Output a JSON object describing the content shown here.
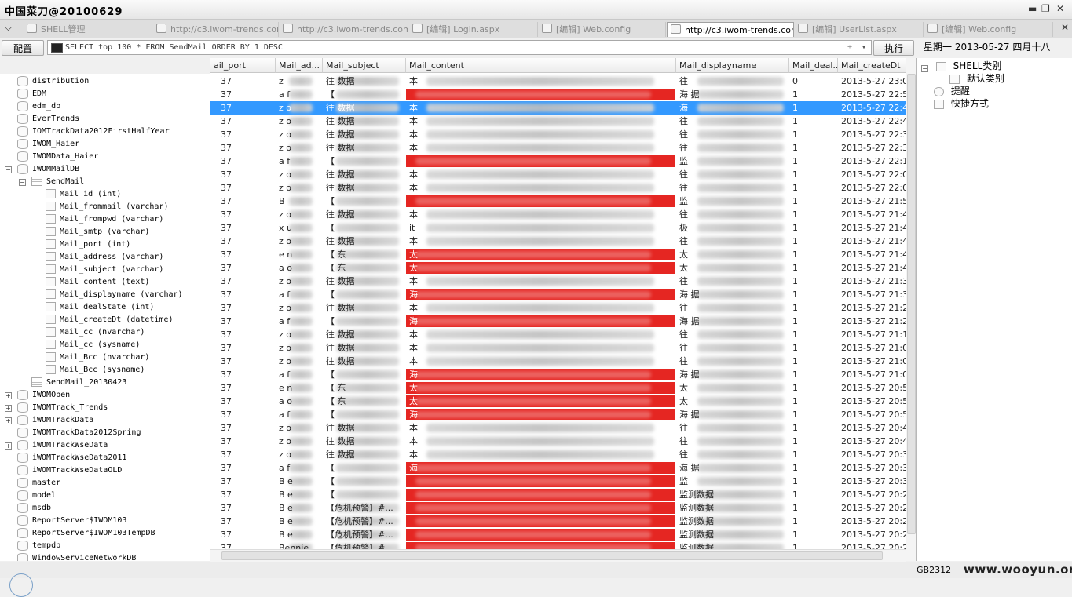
{
  "window": {
    "title": "中国菜刀@20100629",
    "controls": [
      "▬",
      "❐",
      "✕"
    ]
  },
  "tabs": [
    {
      "label": "SHELL管理",
      "active": false
    },
    {
      "label": "http://c3.iwom-trends.com...",
      "active": false
    },
    {
      "label": "http://c3.iwom-trends.com...",
      "active": false
    },
    {
      "label": "[编辑] Login.aspx",
      "active": false
    },
    {
      "label": "[编辑] Web.config",
      "active": false
    },
    {
      "label": "http://c3.iwom-trends.com...",
      "active": true
    },
    {
      "label": "[编辑] UserList.aspx",
      "active": false
    },
    {
      "label": "[编辑] Web.config",
      "active": false
    }
  ],
  "toolbar": {
    "config_label": "配置",
    "sql": "SELECT top 100 * FROM SendMail ORDER BY 1 DESC",
    "execute_label": "执行",
    "datetime": "星期一 2013-05-27 四月十八"
  },
  "db_tree": [
    {
      "label": "distribution",
      "level": 0,
      "expander": ""
    },
    {
      "label": "EDM",
      "level": 0,
      "expander": ""
    },
    {
      "label": "edm_db",
      "level": 0,
      "expander": ""
    },
    {
      "label": "EverTrends",
      "level": 0,
      "expander": ""
    },
    {
      "label": "IOMTrackData2012FirstHalfYear",
      "level": 0,
      "expander": ""
    },
    {
      "label": "IWOM_Haier",
      "level": 0,
      "expander": ""
    },
    {
      "label": "IWOMData_Haier",
      "level": 0,
      "expander": ""
    },
    {
      "label": "IWOMMailDB",
      "level": 0,
      "expander": "−"
    },
    {
      "label": "SendMail",
      "level": 1,
      "expander": "−",
      "kind": "tbl"
    },
    {
      "label": "Mail_id (int)",
      "level": 2,
      "expander": "",
      "kind": "col"
    },
    {
      "label": "Mail_frommail (varchar)",
      "level": 2,
      "expander": "",
      "kind": "col"
    },
    {
      "label": "Mail_frompwd (varchar)",
      "level": 2,
      "expander": "",
      "kind": "col"
    },
    {
      "label": "Mail_smtp (varchar)",
      "level": 2,
      "expander": "",
      "kind": "col"
    },
    {
      "label": "Mail_port (int)",
      "level": 2,
      "expander": "",
      "kind": "col"
    },
    {
      "label": "Mail_address (varchar)",
      "level": 2,
      "expander": "",
      "kind": "col"
    },
    {
      "label": "Mail_subject (varchar)",
      "level": 2,
      "expander": "",
      "kind": "col"
    },
    {
      "label": "Mail_content (text)",
      "level": 2,
      "expander": "",
      "kind": "col"
    },
    {
      "label": "Mail_displayname (varchar)",
      "level": 2,
      "expander": "",
      "kind": "col"
    },
    {
      "label": "Mail_dealState (int)",
      "level": 2,
      "expander": "",
      "kind": "col"
    },
    {
      "label": "Mail_createDt (datetime)",
      "level": 2,
      "expander": "",
      "kind": "col"
    },
    {
      "label": "Mail_cc (nvarchar)",
      "level": 2,
      "expander": "",
      "kind": "col"
    },
    {
      "label": "Mail_cc (sysname)",
      "level": 2,
      "expander": "",
      "kind": "col"
    },
    {
      "label": "Mail_Bcc (nvarchar)",
      "level": 2,
      "expander": "",
      "kind": "col"
    },
    {
      "label": "Mail_Bcc (sysname)",
      "level": 2,
      "expander": "",
      "kind": "col"
    },
    {
      "label": "SendMail_20130423",
      "level": 1,
      "expander": "",
      "kind": "tbl"
    },
    {
      "label": "IWOMOpen",
      "level": 0,
      "expander": "+"
    },
    {
      "label": "IWOMTrack_Trends",
      "level": 0,
      "expander": "+"
    },
    {
      "label": "iWOMTrackData",
      "level": 0,
      "expander": "+"
    },
    {
      "label": "IWOMTrackData2012Spring",
      "level": 0,
      "expander": ""
    },
    {
      "label": "iWOMTrackWseData",
      "level": 0,
      "expander": "+"
    },
    {
      "label": "iWOMTrackWseData2011",
      "level": 0,
      "expander": ""
    },
    {
      "label": "iWOMTrackWseDataOLD",
      "level": 0,
      "expander": ""
    },
    {
      "label": "master",
      "level": 0,
      "expander": ""
    },
    {
      "label": "model",
      "level": 0,
      "expander": ""
    },
    {
      "label": "msdb",
      "level": 0,
      "expander": ""
    },
    {
      "label": "ReportServer$IWOM103",
      "level": 0,
      "expander": ""
    },
    {
      "label": "ReportServer$IWOM103TempDB",
      "level": 0,
      "expander": ""
    },
    {
      "label": "tempdb",
      "level": 0,
      "expander": ""
    },
    {
      "label": "WindowServiceNetworkDB",
      "level": 0,
      "expander": ""
    }
  ],
  "grid": {
    "columns": [
      "ail_port",
      "Mail_ad...",
      "Mail_subject",
      "Mail_content",
      "Mail_displayname",
      "Mail_deal...",
      "Mail_createDt"
    ],
    "rows": [
      {
        "port": "37",
        "addr": "z",
        "subject": "往 数据",
        "content": "本",
        "red": false,
        "display": "往",
        "deal": "0",
        "created": "2013-5-27 23:0",
        "sel": false
      },
      {
        "port": "37",
        "addr": "a  f",
        "subject": "【",
        "content": "",
        "red": true,
        "display": "海  据",
        "deal": "1",
        "created": "2013-5-27 22:5",
        "sel": false
      },
      {
        "port": "37",
        "addr": "z  o",
        "subject": "往 数据",
        "content": "本",
        "red": false,
        "display": "海",
        "deal": "1",
        "created": "2013-5-27 22:4",
        "sel": true
      },
      {
        "port": "37",
        "addr": "z  o",
        "subject": "往 数据",
        "content": "本",
        "red": false,
        "display": "往",
        "deal": "1",
        "created": "2013-5-27 22:4",
        "sel": false
      },
      {
        "port": "37",
        "addr": "z  o",
        "subject": "往 数据",
        "content": "本",
        "red": false,
        "display": "往",
        "deal": "1",
        "created": "2013-5-27 22:3",
        "sel": false
      },
      {
        "port": "37",
        "addr": "z  o",
        "subject": "往 数据",
        "content": "本",
        "red": false,
        "display": "往",
        "deal": "1",
        "created": "2013-5-27 22:3",
        "sel": false
      },
      {
        "port": "37",
        "addr": "a  f",
        "subject": "【",
        "content": "",
        "red": true,
        "display": "监",
        "deal": "1",
        "created": "2013-5-27 22:1",
        "sel": false
      },
      {
        "port": "37",
        "addr": "z  o",
        "subject": "往 数据",
        "content": "本",
        "red": false,
        "display": "往",
        "deal": "1",
        "created": "2013-5-27 22:0",
        "sel": false
      },
      {
        "port": "37",
        "addr": "z  o",
        "subject": "往 数据",
        "content": "本",
        "red": false,
        "display": "往",
        "deal": "1",
        "created": "2013-5-27 22:0",
        "sel": false
      },
      {
        "port": "37",
        "addr": "B",
        "subject": "【",
        "content": "",
        "red": true,
        "display": "监",
        "deal": "1",
        "created": "2013-5-27 21:5",
        "sel": false
      },
      {
        "port": "37",
        "addr": "z  o",
        "subject": "往 数据",
        "content": "本",
        "red": false,
        "display": "往",
        "deal": "1",
        "created": "2013-5-27 21:4",
        "sel": false
      },
      {
        "port": "37",
        "addr": "x  u",
        "subject": "【",
        "content": "it",
        "red": false,
        "display": "极",
        "deal": "1",
        "created": "2013-5-27 21:4",
        "sel": false
      },
      {
        "port": "37",
        "addr": "z  o",
        "subject": "往 数据",
        "content": "本",
        "red": false,
        "display": "往",
        "deal": "1",
        "created": "2013-5-27 21:4",
        "sel": false
      },
      {
        "port": "37",
        "addr": "e  n",
        "subject": "【 东",
        "content": "太",
        "red": true,
        "display": "太",
        "deal": "1",
        "created": "2013-5-27 21:4",
        "sel": false
      },
      {
        "port": "37",
        "addr": "a  o",
        "subject": "【 东",
        "content": "太",
        "red": true,
        "display": "太",
        "deal": "1",
        "created": "2013-5-27 21:4",
        "sel": false
      },
      {
        "port": "37",
        "addr": "z  o",
        "subject": "往 数据",
        "content": "本",
        "red": false,
        "display": "往",
        "deal": "1",
        "created": "2013-5-27 21:3",
        "sel": false
      },
      {
        "port": "37",
        "addr": "a  f",
        "subject": "【",
        "content": "海",
        "red": true,
        "display": "海  据",
        "deal": "1",
        "created": "2013-5-27 21:3",
        "sel": false
      },
      {
        "port": "37",
        "addr": "z  o",
        "subject": "往 数据",
        "content": "本",
        "red": false,
        "display": "往",
        "deal": "1",
        "created": "2013-5-27 21:2",
        "sel": false
      },
      {
        "port": "37",
        "addr": "a  f",
        "subject": "【",
        "content": "海",
        "red": true,
        "display": "海  据",
        "deal": "1",
        "created": "2013-5-27 21:2",
        "sel": false
      },
      {
        "port": "37",
        "addr": "z  o",
        "subject": "往 数据",
        "content": "本",
        "red": false,
        "display": "往",
        "deal": "1",
        "created": "2013-5-27 21:1",
        "sel": false
      },
      {
        "port": "37",
        "addr": "z  o",
        "subject": "往 数据",
        "content": "本",
        "red": false,
        "display": "往",
        "deal": "1",
        "created": "2013-5-27 21:0",
        "sel": false
      },
      {
        "port": "37",
        "addr": "z  o",
        "subject": "往 数据",
        "content": "本",
        "red": false,
        "display": "往",
        "deal": "1",
        "created": "2013-5-27 21:0",
        "sel": false
      },
      {
        "port": "37",
        "addr": "a  f",
        "subject": "【",
        "content": "海",
        "red": true,
        "display": "海  据",
        "deal": "1",
        "created": "2013-5-27 21:0",
        "sel": false
      },
      {
        "port": "37",
        "addr": "e  n",
        "subject": "【 东",
        "content": "太",
        "red": true,
        "display": "太",
        "deal": "1",
        "created": "2013-5-27 20:5",
        "sel": false
      },
      {
        "port": "37",
        "addr": "a  o",
        "subject": "【 东",
        "content": "太",
        "red": true,
        "display": "太",
        "deal": "1",
        "created": "2013-5-27 20:5",
        "sel": false
      },
      {
        "port": "37",
        "addr": "a  f",
        "subject": "【",
        "content": "海",
        "red": true,
        "display": "海  据",
        "deal": "1",
        "created": "2013-5-27 20:5",
        "sel": false
      },
      {
        "port": "37",
        "addr": "z  o",
        "subject": "往 数据",
        "content": "本",
        "red": false,
        "display": "往",
        "deal": "1",
        "created": "2013-5-27 20:4",
        "sel": false
      },
      {
        "port": "37",
        "addr": "z  o",
        "subject": "往 数据",
        "content": "本",
        "red": false,
        "display": "往",
        "deal": "1",
        "created": "2013-5-27 20:4",
        "sel": false
      },
      {
        "port": "37",
        "addr": "z  o",
        "subject": "往 数据",
        "content": "本",
        "red": false,
        "display": "往",
        "deal": "1",
        "created": "2013-5-27 20:3",
        "sel": false
      },
      {
        "port": "37",
        "addr": "a  f",
        "subject": "【",
        "content": "海",
        "red": true,
        "display": "海  据",
        "deal": "1",
        "created": "2013-5-27 20:3",
        "sel": false
      },
      {
        "port": "37",
        "addr": "B  e",
        "subject": "【",
        "content": "",
        "red": true,
        "display": "监",
        "deal": "1",
        "created": "2013-5-27 20:3",
        "sel": false
      },
      {
        "port": "37",
        "addr": "B  e",
        "subject": "【",
        "content": "",
        "red": true,
        "display": "监测数据",
        "deal": "1",
        "created": "2013-5-27 20:2",
        "sel": false
      },
      {
        "port": "37",
        "addr": "B  e",
        "subject": "【危机预警】#...",
        "content": "",
        "red": true,
        "display": "监测数据",
        "deal": "1",
        "created": "2013-5-27 20:2",
        "sel": false
      },
      {
        "port": "37",
        "addr": "B  e",
        "subject": "【危机预警】#...",
        "content": "",
        "red": true,
        "display": "监测数据",
        "deal": "1",
        "created": "2013-5-27 20:2",
        "sel": false
      },
      {
        "port": "37",
        "addr": "B  e",
        "subject": "【危机预警】#...",
        "content": "",
        "red": true,
        "display": "监测数据",
        "deal": "1",
        "created": "2013-5-27 20:2",
        "sel": false
      },
      {
        "port": "37",
        "addr": "Bennie",
        "subject": "【危机预警】#...",
        "content": "",
        "red": true,
        "display": "监测数据",
        "deal": "1",
        "created": "2013-5-27 20:2",
        "sel": false
      }
    ]
  },
  "right_panel": {
    "items": [
      {
        "label": "SHELL类别",
        "level": 0,
        "icon": "folder-icon"
      },
      {
        "label": "默认类别",
        "level": 1,
        "icon": "page-icon"
      },
      {
        "label": "提醒",
        "level": 0,
        "icon": "clock-icon"
      },
      {
        "label": "快捷方式",
        "level": 0,
        "icon": "hand-icon"
      }
    ]
  },
  "status": {
    "encoding": "GB2312",
    "watermark": "www.wooyun.org"
  },
  "colors": {
    "selection": "#3399ff",
    "redacted": "#e52622"
  }
}
